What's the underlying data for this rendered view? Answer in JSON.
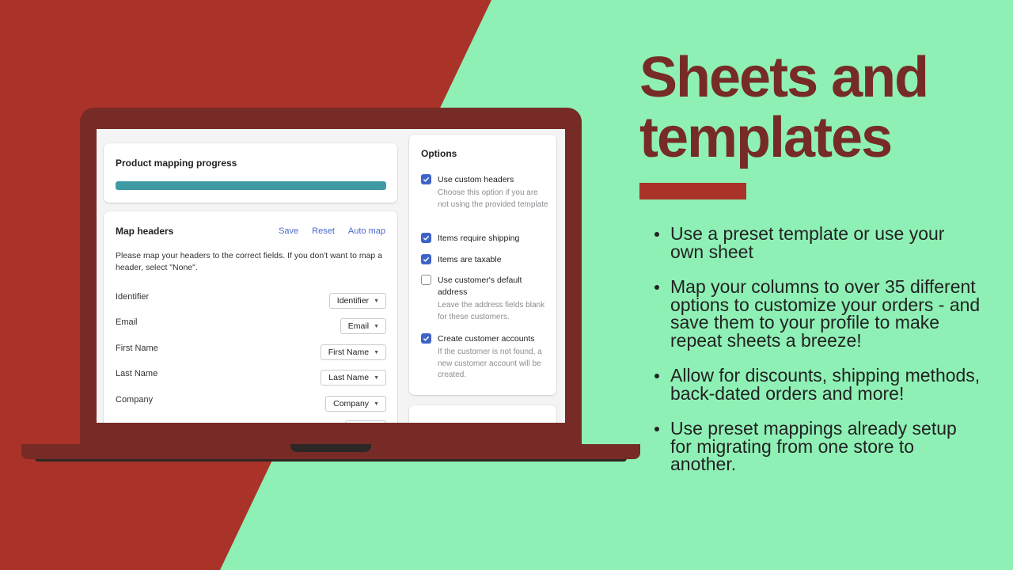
{
  "colors": {
    "bg_red": "#a93329",
    "bg_green": "#8ef0b5",
    "laptop": "#772b26",
    "headline": "#772b26",
    "progress": "#3f9aa3",
    "link": "#4a6bc7",
    "checkbox": "#3e63c7"
  },
  "app": {
    "progress_card": {
      "title": "Product mapping progress",
      "progress_fraction": 1.0
    },
    "map_headers": {
      "title": "Map headers",
      "actions": [
        "Save",
        "Reset",
        "Auto map"
      ],
      "description": "Please map your headers to the correct fields. If you don't want to map a header, select \"None\".",
      "rows": [
        {
          "label": "Identifier",
          "value": "Identifier"
        },
        {
          "label": "Email",
          "value": "Email"
        },
        {
          "label": "First Name",
          "value": "First Name"
        },
        {
          "label": "Last Name",
          "value": "Last Name"
        },
        {
          "label": "Company",
          "value": "Company"
        }
      ]
    },
    "options": {
      "title": "Options",
      "items": [
        {
          "label": "Use custom headers",
          "checked": true,
          "help": "Choose this option if you are not using the provided template"
        },
        {
          "label": "Items require shipping",
          "checked": true,
          "help": ""
        },
        {
          "label": "Items are taxable",
          "checked": true,
          "help": ""
        },
        {
          "label": "Use customer's default address",
          "checked": false,
          "help": "Leave the address fields blank for these customers."
        },
        {
          "label": "Create customer accounts",
          "checked": true,
          "help": "If the customer is not found, a new customer account will be created."
        }
      ]
    }
  },
  "marketing": {
    "headline": "Sheets and templates",
    "bullets": [
      "Use a preset template or use your own sheet",
      "Map your columns to over 35 different options to customize your orders - and save them to your profile to make repeat sheets a breeze!",
      "Allow for discounts, shipping methods, back-dated orders and more!",
      "Use preset mappings already setup for migrating from one store to another."
    ]
  }
}
